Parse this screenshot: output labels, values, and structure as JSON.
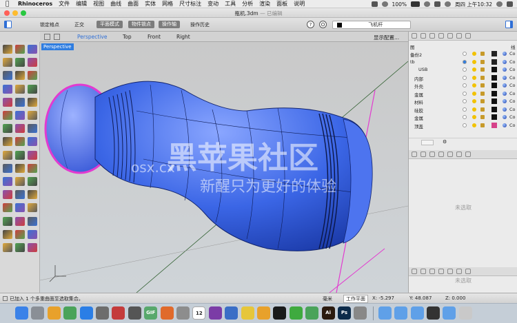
{
  "menubar": {
    "app_name": "Rhinoceros",
    "items": [
      "文件",
      "编辑",
      "视图",
      "曲线",
      "曲面",
      "实体",
      "网格",
      "尺寸标注",
      "变动",
      "工具",
      "分析",
      "渲染",
      "面板",
      "说明"
    ],
    "battery": "100%",
    "clock": "周四 上午10:32"
  },
  "window": {
    "title": "瓶机.3dm",
    "title_suffix": "— 已编辑"
  },
  "toolbar": {
    "lock_grid": "锁定格点",
    "ortho": "正交",
    "planar": "平面模式",
    "obj_snap": "物件锁点",
    "smart_track": "操作轴",
    "record_history": "操作历史",
    "layer_value": "飞机杆"
  },
  "viewport_tabs": {
    "tabs": [
      "Perspective",
      "Top",
      "Front",
      "Right"
    ],
    "active": "Perspective",
    "options": "显示配置..."
  },
  "viewport": {
    "label": "Perspective",
    "colors": {
      "object": "#3f6fe0",
      "selection": "#e23ad0",
      "background": "#c7cbcf"
    }
  },
  "layers_panel": {
    "header_left": "图",
    "header_right": "线",
    "layers": [
      {
        "name": "备份2",
        "indent": 0,
        "color": "#222222"
      },
      {
        "name": "tb",
        "indent": 0,
        "color": "#222222",
        "current": true
      },
      {
        "name": "USB",
        "indent": 2,
        "color": "#111111"
      },
      {
        "name": "内部",
        "indent": 1,
        "color": "#111111"
      },
      {
        "name": "外壳",
        "indent": 1,
        "color": "#111111"
      },
      {
        "name": "金属",
        "indent": 1,
        "color": "#111111"
      },
      {
        "name": "材料",
        "indent": 1,
        "color": "#111111"
      },
      {
        "name": "硅胶",
        "indent": 1,
        "color": "#111111"
      },
      {
        "name": "金属",
        "indent": 1,
        "color": "#111111"
      },
      {
        "name": "顶盖",
        "indent": 1,
        "color": "#d6428a"
      }
    ],
    "column_suffix": "Co",
    "empty_label_1": "未选取",
    "empty_label_2": "未选取"
  },
  "statusbar": {
    "message": "已加入 1 个多重曲面至选取集合。",
    "unit_label": "毫米",
    "plane": "工作平面",
    "x": "X: -5.297",
    "y": "Y: 48.087",
    "z": "Z: 0.000"
  },
  "watermark": {
    "cn": "黑苹果社区",
    "domain": "osx.cx",
    "slogan": "新醒只为更好的体验"
  },
  "dock": {
    "icons": [
      {
        "name": "finder",
        "color": "#3b82e8"
      },
      {
        "name": "launchpad",
        "color": "#8a8f96"
      },
      {
        "name": "chrome",
        "color": "#e8a12b"
      },
      {
        "name": "preview",
        "color": "#4aa35a"
      },
      {
        "name": "app-store",
        "color": "#2a7ee6"
      },
      {
        "name": "photos",
        "color": "#6d6d6d"
      },
      {
        "name": "photo-booth",
        "color": "#c43b3b"
      },
      {
        "name": "clapper",
        "color": "#555555"
      },
      {
        "name": "gif",
        "color": "#58a86c"
      },
      {
        "name": "maps",
        "color": "#e06a2b"
      },
      {
        "name": "system-preferences",
        "color": "#8d8d8d"
      },
      {
        "name": "calendar",
        "color": "#ffffff"
      },
      {
        "name": "onenote",
        "color": "#7b3ca6"
      },
      {
        "name": "books",
        "color": "#3a6ec6"
      },
      {
        "name": "notes",
        "color": "#e6c63a"
      },
      {
        "name": "butterfly",
        "color": "#e8a12b"
      },
      {
        "name": "qq",
        "color": "#1a1a1a"
      },
      {
        "name": "wechat",
        "color": "#3faa3f"
      },
      {
        "name": "messages",
        "color": "#4aa35a"
      },
      {
        "name": "illustrator",
        "color": "#2b1a0e"
      },
      {
        "name": "photoshop",
        "color": "#0b2a4a"
      },
      {
        "name": "trash-app",
        "color": "#888888"
      },
      {
        "name": "folder-1",
        "color": "#5fa0e8"
      },
      {
        "name": "folder-2",
        "color": "#5fa0e8"
      },
      {
        "name": "folder-3",
        "color": "#5fa0e8"
      },
      {
        "name": "display",
        "color": "#333333"
      },
      {
        "name": "folder-4",
        "color": "#5fa0e8"
      },
      {
        "name": "trash",
        "color": "#c9c9c9"
      }
    ],
    "labels": {
      "calendar": "12",
      "illustrator": "Ai",
      "photoshop": "Ps",
      "gif": "GIF"
    }
  }
}
